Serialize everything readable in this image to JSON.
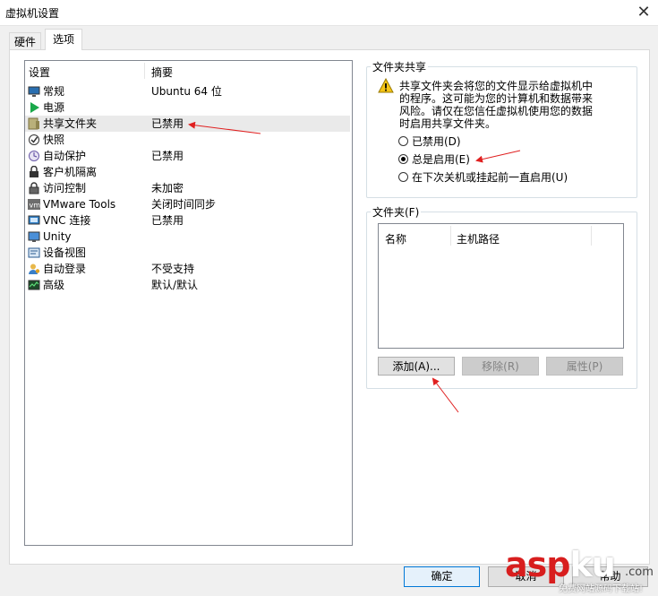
{
  "window": {
    "title": "虚拟机设置",
    "close_label": "✕"
  },
  "tabs": [
    {
      "label": "硬件"
    },
    {
      "label": "选项"
    }
  ],
  "settings_list": {
    "header_name": "设置",
    "header_summary": "摘要",
    "items": [
      {
        "icon": "monitor-icon",
        "name": "常规",
        "summary": "Ubuntu 64 位"
      },
      {
        "icon": "power-icon",
        "name": "电源",
        "summary": ""
      },
      {
        "icon": "shared-folder-icon",
        "name": "共享文件夹",
        "summary": "已禁用"
      },
      {
        "icon": "snapshot-icon",
        "name": "快照",
        "summary": ""
      },
      {
        "icon": "autoprotect-icon",
        "name": "自动保护",
        "summary": "已禁用"
      },
      {
        "icon": "guest-isolation-icon",
        "name": "客户机隔离",
        "summary": ""
      },
      {
        "icon": "lock-icon",
        "name": "访问控制",
        "summary": "未加密"
      },
      {
        "icon": "vmware-tools-icon",
        "name": "VMware Tools",
        "summary": "关闭时间同步"
      },
      {
        "icon": "vnc-icon",
        "name": "VNC 连接",
        "summary": "已禁用"
      },
      {
        "icon": "unity-icon",
        "name": "Unity",
        "summary": ""
      },
      {
        "icon": "device-view-icon",
        "name": "设备视图",
        "summary": ""
      },
      {
        "icon": "autologin-icon",
        "name": "自动登录",
        "summary": "不受支持"
      },
      {
        "icon": "advanced-icon",
        "name": "高级",
        "summary": "默认/默认"
      }
    ]
  },
  "folder_sharing": {
    "label": "文件夹共享",
    "warning_lines": [
      "共享文件夹会将您的文件显示给虚拟机中",
      "的程序。这可能为您的计算机和数据带来",
      "风险。请仅在您信任虚拟机使用您的数据",
      "时启用共享文件夹。"
    ],
    "options": [
      {
        "label": "已禁用(D)",
        "selected": false
      },
      {
        "label": "总是启用(E)",
        "selected": true
      },
      {
        "label": "在下次关机或挂起前一直启用(U)",
        "selected": false
      }
    ]
  },
  "folders": {
    "label": "文件夹(F)",
    "col_name": "名称",
    "col_path": "主机路径",
    "add_label": "添加(A)...",
    "remove_label": "移除(R)",
    "properties_label": "属性(P)"
  },
  "footer": {
    "ok_label": "确定",
    "cancel_label": "取消",
    "help_label": "帮助"
  },
  "watermark": {
    "logo_asp": "asp",
    "logo_ku": "ku",
    "logo_com": ".com",
    "subtitle": "免费网站源码下载站!"
  },
  "colors": {
    "annotation_arrow": "#e02020",
    "accent": "#0078d7"
  }
}
